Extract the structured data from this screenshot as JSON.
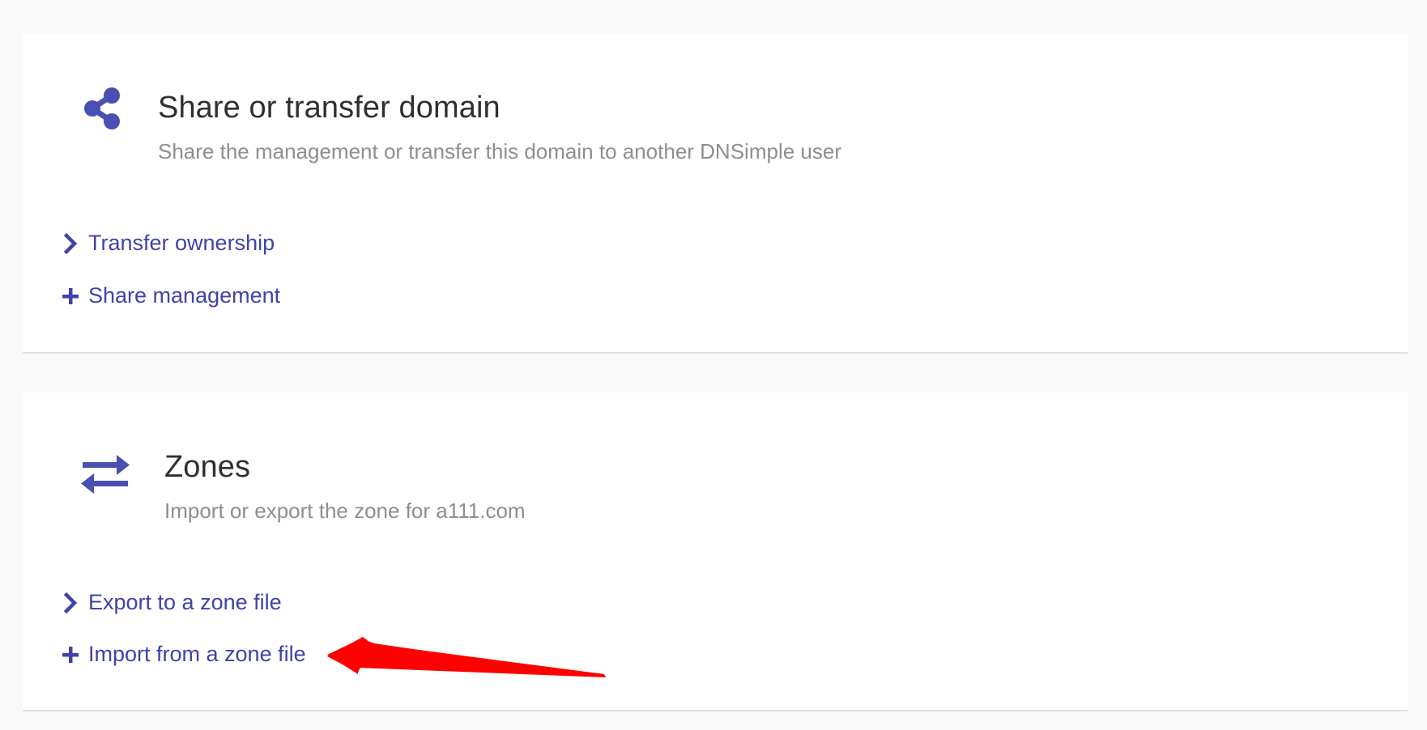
{
  "sections": [
    {
      "title": "Share or transfer domain",
      "description": "Share the management or transfer this domain to another DNSimple user",
      "icon": "share-icon",
      "actions": [
        {
          "label": "Transfer ownership",
          "icon": "chevron-right-icon"
        },
        {
          "label": "Share management",
          "icon": "plus-icon"
        }
      ]
    },
    {
      "title": "Zones",
      "description": "Import or export the zone for a111.com",
      "icon": "exchange-arrows-icon",
      "actions": [
        {
          "label": "Export to a zone file",
          "icon": "chevron-right-icon"
        },
        {
          "label": "Import from a zone file",
          "icon": "plus-icon"
        }
      ]
    }
  ],
  "colors": {
    "accent": "#4a4fb3",
    "link": "#3f43a9",
    "title": "#2f2f2f",
    "muted": "#8e8e8e",
    "annotation": "#ff0000",
    "background": "#f9f9f9",
    "card": "#ffffff"
  }
}
